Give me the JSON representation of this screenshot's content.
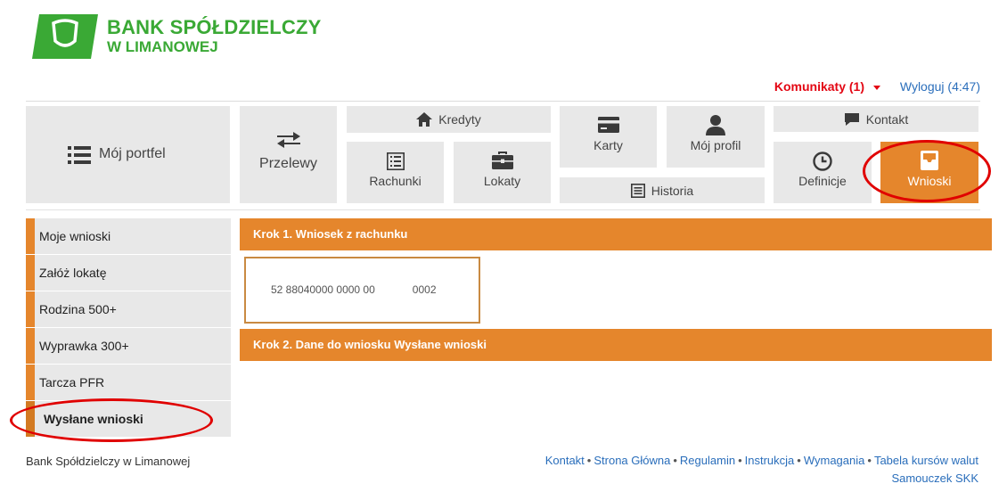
{
  "brand": {
    "line1": "BANK SPÓŁDZIELCZY",
    "line2": "W LIMANOWEJ",
    "color": "#3aa935"
  },
  "top_bar": {
    "komunikaty": "Komunikaty (1)",
    "wyloguj": "Wyloguj (4:47)"
  },
  "menu": {
    "moj_portfel": "Mój portfel",
    "przelewy": "Przelewy",
    "kredyty": "Kredyty",
    "rachunki": "Rachunki",
    "lokaty": "Lokaty",
    "karty": "Karty",
    "moj_profil": "Mój profil",
    "historia": "Historia",
    "kontakt": "Kontakt",
    "definicje": "Definicje",
    "wnioski": "Wnioski",
    "active": "wnioski",
    "accent_color": "#e5862c"
  },
  "sidebar": {
    "items": [
      {
        "label": "Moje wnioski"
      },
      {
        "label": "Załóż lokatę"
      },
      {
        "label": "Rodzina 500+"
      },
      {
        "label": "Wyprawka 300+"
      },
      {
        "label": "Tarcza PFR"
      },
      {
        "label": "Wysłane wnioski",
        "active": true
      }
    ]
  },
  "content": {
    "step1": "Krok 1. Wniosek z rachunku",
    "account_number_start": "52 88040000 0000 00",
    "account_number_end": "0002",
    "step2": "Krok 2. Dane do wniosku Wysłane wnioski"
  },
  "footer": {
    "bank_name": "Bank Spółdzielczy w Limanowej",
    "links": [
      "Kontakt",
      "Strona Główna",
      "Regulamin",
      "Instrukcja",
      "Wymagania",
      "Tabela kursów walut"
    ],
    "separator": "•",
    "link_samouczek": "Samouczek SKK"
  },
  "annotations": {
    "highlight_color": "#e00000"
  }
}
